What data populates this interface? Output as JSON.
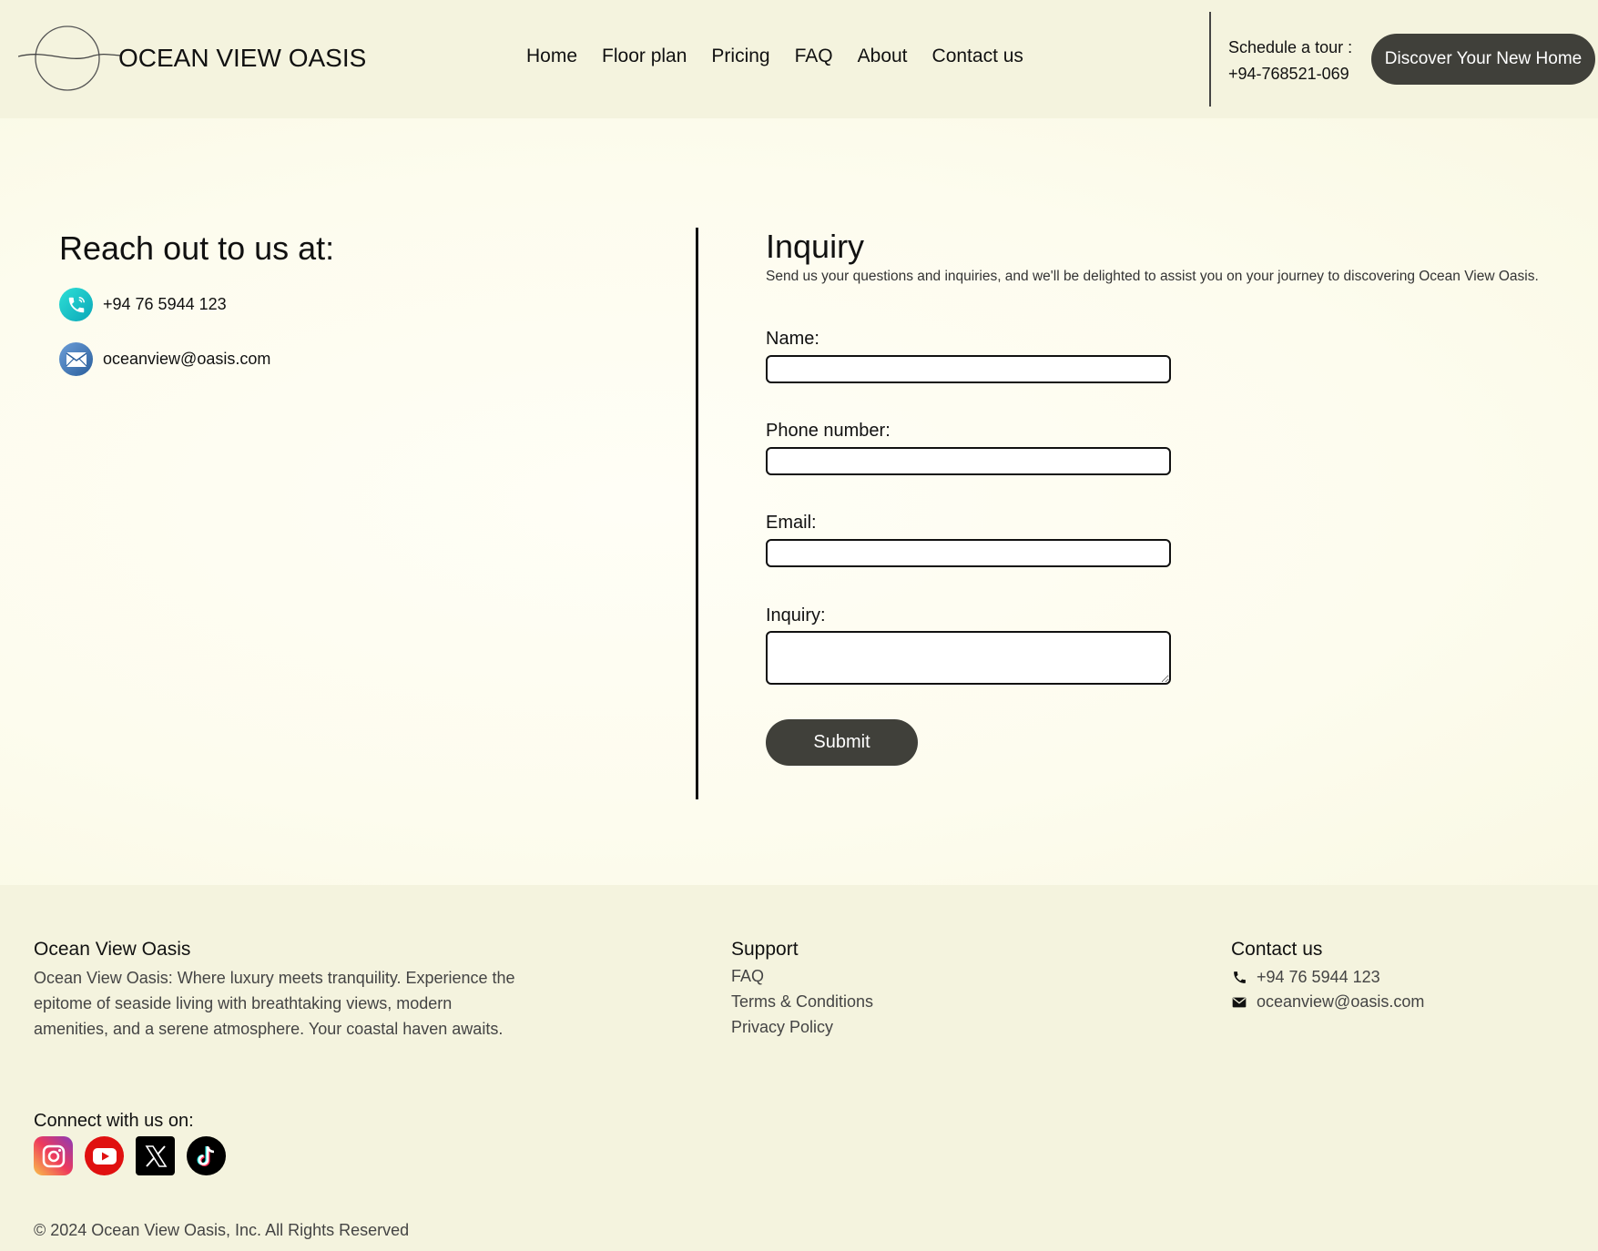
{
  "header": {
    "logo_text": "OCEAN VIEW OASIS",
    "nav": [
      "Home",
      "Floor plan",
      "Pricing",
      "FAQ",
      "About",
      "Contact us"
    ],
    "tour_label": "Schedule a tour :",
    "tour_phone": "+94-768521-069",
    "cta_label": "Discover Your New Home"
  },
  "reach": {
    "title": "Reach out to us at:",
    "phone": "+94 76 5944 123",
    "email": "oceanview@oasis.com",
    "phone_icon": "phone-icon",
    "email_icon": "mail-icon"
  },
  "inquiry": {
    "title": "Inquiry",
    "subtitle": "Send us your questions and inquiries, and we'll be delighted to assist you on your journey to discovering Ocean View Oasis.",
    "name_label": "Name:",
    "phone_label": "Phone number:",
    "email_label": "Email:",
    "inquiry_label": "Inquiry:",
    "name_value": "",
    "phone_value": "",
    "email_value": "",
    "inquiry_value": "",
    "submit_label": "Submit"
  },
  "footer": {
    "brand_title": "Ocean View Oasis",
    "brand_text": "Ocean View Oasis: Where luxury meets tranquility. Experience the epitome of seaside living with breathtaking views, modern amenities, and a serene atmosphere. Your coastal haven awaits.",
    "support_title": "Support",
    "support_links": [
      "FAQ",
      "Terms & Conditions",
      "Privacy Policy"
    ],
    "contact_title": "Contact us",
    "contact_phone": "+94 76 5944 123",
    "contact_email": "oceanview@oasis.com",
    "connect_title": "Connect with us on:",
    "socials": [
      "instagram-icon",
      "youtube-icon",
      "x-icon",
      "tiktok-icon"
    ],
    "copyright": "© 2024 Ocean View Oasis, Inc. All Rights Reserved"
  },
  "colors": {
    "header_bg": "#f4f3de",
    "button_bg": "#40403a",
    "page_bg": "#fdfcf0"
  }
}
